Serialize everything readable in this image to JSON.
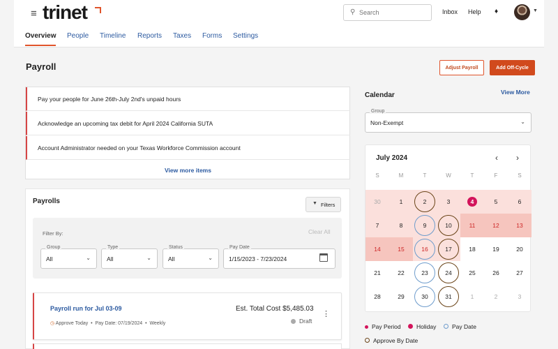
{
  "app": {
    "logo": "trinet",
    "search_placeholder": "Search",
    "header_links": [
      "Inbox",
      "Help"
    ],
    "icons": [
      "menu-icon",
      "search-icon",
      "bell-icon",
      "avatar"
    ],
    "accent_color": "#d14a1d",
    "link_color": "#2c5aa0"
  },
  "tabs": [
    "Overview",
    "People",
    "Timeline",
    "Reports",
    "Taxes",
    "Forms",
    "Settings"
  ],
  "page": {
    "title": "Payroll",
    "adjust_label": "Adjust Payroll",
    "offcycle_label": "Add Off-Cycle"
  },
  "alerts": {
    "items": [
      "Pay your people for June 26th-July 2nd's unpaid hours",
      "Acknowledge an upcoming tax debit for April 2024 California SUTA",
      "Account Administrator needed on your Texas Workforce Commission account"
    ],
    "view_more": "View more items"
  },
  "payrolls": {
    "title": "Payrolls",
    "filters_label": "Filters",
    "filter_by": "Filter By:",
    "clear_all": "Clear All",
    "fields": {
      "group": {
        "label": "Group",
        "value": "All"
      },
      "type": {
        "label": "Type",
        "value": "All"
      },
      "status": {
        "label": "Status",
        "value": "All"
      },
      "pay_date": {
        "label": "Pay Date",
        "value": "1/15/2023 - 7/23/2024"
      }
    },
    "card": {
      "title": "Payroll run for Jul 03-09",
      "approve": "Approve Today",
      "pay_date": "Pay Date: 07/19/2024",
      "frequency": "Weekly",
      "cost": "Est. Total Cost $5,485.03",
      "status": "Draft"
    }
  },
  "calendar": {
    "title": "Calendar",
    "view_more": "View More",
    "group": {
      "label": "Group",
      "value": "Non-Exempt"
    },
    "month": "July 2024",
    "dow": [
      "S",
      "M",
      "T",
      "W",
      "T",
      "F",
      "S"
    ],
    "weeks": [
      [
        "30",
        "1",
        "2",
        "3",
        "4",
        "5",
        "6"
      ],
      [
        "7",
        "8",
        "9",
        "10",
        "11",
        "12",
        "13"
      ],
      [
        "14",
        "15",
        "16",
        "17",
        "18",
        "19",
        "20"
      ],
      [
        "21",
        "22",
        "23",
        "24",
        "25",
        "26",
        "27"
      ],
      [
        "28",
        "29",
        "30",
        "31",
        "1",
        "2",
        "3"
      ]
    ],
    "legend": {
      "pay_period": "Pay Period",
      "holiday": "Holiday",
      "pay_date": "Pay Date",
      "approve_by": "Approve By Date"
    },
    "colors": {
      "pay_period": "#fbe0dc",
      "holiday": "#f6c5be",
      "pay_date_ring": "#6e9ccc",
      "approve_ring": "#6a4418",
      "today": "#d3145b"
    }
  }
}
